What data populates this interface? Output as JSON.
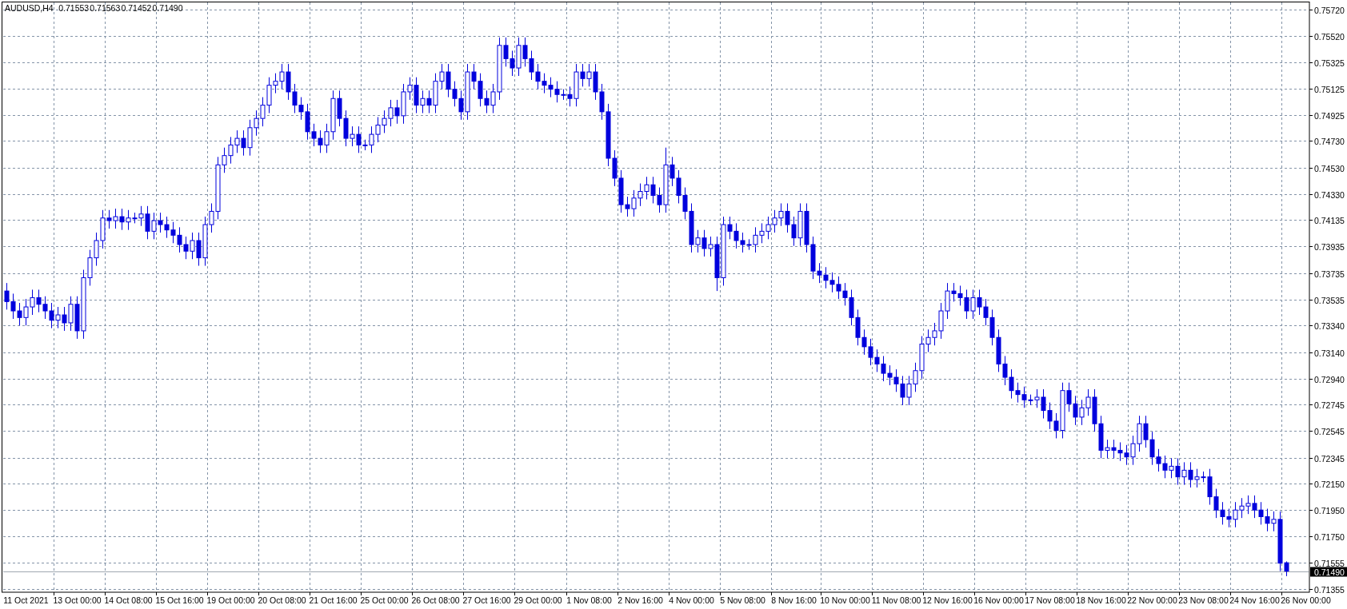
{
  "symbol": "AUDUSD,H4",
  "quote": [
    "0.71553",
    "0.71563",
    "0.71452",
    "0.71490"
  ],
  "chart_data": {
    "type": "candlestick",
    "grid": true,
    "ylim": [
      0.71331,
      0.75792
    ],
    "yticks": [
      {
        "value": 0.7572,
        "label": "0.75720"
      },
      {
        "value": 0.7552,
        "label": "0.75520"
      },
      {
        "value": 0.75325,
        "label": "0.75325"
      },
      {
        "value": 0.75125,
        "label": "0.75125"
      },
      {
        "value": 0.74925,
        "label": "0.74925"
      },
      {
        "value": 0.7473,
        "label": "0.74730"
      },
      {
        "value": 0.7453,
        "label": "0.74530"
      },
      {
        "value": 0.7433,
        "label": "0.74330"
      },
      {
        "value": 0.74135,
        "label": "0.74135"
      },
      {
        "value": 0.73935,
        "label": "0.73935"
      },
      {
        "value": 0.73735,
        "label": "0.73735"
      },
      {
        "value": 0.73535,
        "label": "0.73535"
      },
      {
        "value": 0.7334,
        "label": "0.73340"
      },
      {
        "value": 0.7314,
        "label": "0.73140"
      },
      {
        "value": 0.7294,
        "label": "0.72940"
      },
      {
        "value": 0.72745,
        "label": "0.72745"
      },
      {
        "value": 0.72545,
        "label": "0.72545"
      },
      {
        "value": 0.72345,
        "label": "0.72345"
      },
      {
        "value": 0.7215,
        "label": "0.72150"
      },
      {
        "value": 0.7195,
        "label": "0.71950"
      },
      {
        "value": 0.7175,
        "label": "0.71750"
      },
      {
        "value": 0.71555,
        "label": "0.71555"
      },
      {
        "value": 0.71355,
        "label": "0.71355"
      }
    ],
    "categories": [
      null,
      null,
      null,
      "11 Oct 2021",
      null,
      null,
      null,
      null,
      null,
      null,
      null,
      "13 Oct 00:00",
      null,
      null,
      null,
      null,
      null,
      null,
      null,
      "14 Oct 08:00",
      null,
      null,
      null,
      null,
      null,
      null,
      null,
      "15 Oct 16:00",
      null,
      null,
      null,
      null,
      null,
      null,
      null,
      "19 Oct 00:00",
      null,
      null,
      null,
      null,
      null,
      null,
      null,
      "20 Oct 08:00",
      null,
      null,
      null,
      null,
      null,
      null,
      null,
      "21 Oct 16:00",
      null,
      null,
      null,
      null,
      null,
      null,
      null,
      "25 Oct 00:00",
      null,
      null,
      null,
      null,
      null,
      null,
      null,
      "26 Oct 08:00",
      null,
      null,
      null,
      null,
      null,
      null,
      null,
      "27 Oct 16:00",
      null,
      null,
      null,
      null,
      null,
      null,
      null,
      "29 Oct 00:00",
      null,
      null,
      null,
      null,
      null,
      null,
      null,
      "1 Nov 08:00",
      null,
      null,
      null,
      null,
      null,
      null,
      null,
      "2 Nov 16:00",
      null,
      null,
      null,
      null,
      null,
      null,
      null,
      "4 Nov 00:00",
      null,
      null,
      null,
      null,
      null,
      null,
      null,
      "5 Nov 08:00",
      null,
      null,
      null,
      null,
      null,
      null,
      null,
      "8 Nov 16:00",
      null,
      null,
      null,
      null,
      null,
      null,
      null,
      "10 Nov 00:00",
      null,
      null,
      null,
      null,
      null,
      null,
      null,
      "11 Nov 08:00",
      null,
      null,
      null,
      null,
      null,
      null,
      null,
      "12 Nov 16:00",
      null,
      null,
      null,
      null,
      null,
      null,
      null,
      "16 Nov 00:00",
      null,
      null,
      null,
      null,
      null,
      null,
      null,
      "17 Nov 08:00",
      null,
      null,
      null,
      null,
      null,
      null,
      null,
      "18 Nov 16:00",
      null,
      null,
      null,
      null,
      null,
      null,
      null,
      "22 Nov 00:00",
      null,
      null,
      null,
      null,
      null,
      null,
      null,
      "23 Nov 08:00",
      null,
      null,
      null,
      null,
      null,
      null,
      null,
      "24 Nov 16:00",
      null,
      null,
      null,
      null,
      null,
      null,
      null,
      "26 Nov 00:00"
    ],
    "ref_lines": [
      {
        "axis": "y",
        "value": 0.7149,
        "label": "0.71490"
      }
    ],
    "ohlc": [
      [
        0.736,
        0.7366,
        0.7346,
        0.7352
      ],
      [
        0.7352,
        0.7358,
        0.7339,
        0.7345
      ],
      [
        0.7345,
        0.7351,
        0.7334,
        0.734
      ],
      [
        0.734,
        0.7354,
        0.7334,
        0.7348
      ],
      [
        0.7348,
        0.7361,
        0.7342,
        0.7355
      ],
      [
        0.7355,
        0.7361,
        0.7344,
        0.735
      ],
      [
        0.735,
        0.7356,
        0.7339,
        0.7345
      ],
      [
        0.7345,
        0.7351,
        0.7332,
        0.7338
      ],
      [
        0.7338,
        0.7348,
        0.7332,
        0.7342
      ],
      [
        0.7342,
        0.7348,
        0.733,
        0.7336
      ],
      [
        0.7336,
        0.7356,
        0.733,
        0.735
      ],
      [
        0.735,
        0.7356,
        0.7324,
        0.733
      ],
      [
        0.733,
        0.7376,
        0.7324,
        0.737
      ],
      [
        0.737,
        0.7391,
        0.7364,
        0.7385
      ],
      [
        0.7385,
        0.7404,
        0.7379,
        0.7398
      ],
      [
        0.7398,
        0.7421,
        0.7392,
        0.7415
      ],
      [
        0.7415,
        0.7421,
        0.7407,
        0.7413
      ],
      [
        0.7413,
        0.7422,
        0.7407,
        0.7416
      ],
      [
        0.7416,
        0.7422,
        0.7406,
        0.7412
      ],
      [
        0.7412,
        0.7421,
        0.7406,
        0.7415
      ],
      [
        0.7415,
        0.7419,
        0.7411,
        0.7415
      ],
      [
        0.7415,
        0.7424,
        0.7409,
        0.7418
      ],
      [
        0.7418,
        0.7424,
        0.7399,
        0.7405
      ],
      [
        0.7405,
        0.7419,
        0.7399,
        0.7413
      ],
      [
        0.7413,
        0.7419,
        0.7404,
        0.741
      ],
      [
        0.741,
        0.7416,
        0.74,
        0.7406
      ],
      [
        0.7406,
        0.7412,
        0.7396,
        0.7402
      ],
      [
        0.7402,
        0.7408,
        0.7389,
        0.7395
      ],
      [
        0.7395,
        0.7401,
        0.7384,
        0.739
      ],
      [
        0.739,
        0.7404,
        0.7384,
        0.7398
      ],
      [
        0.7398,
        0.7404,
        0.7379,
        0.7385
      ],
      [
        0.7385,
        0.7416,
        0.7379,
        0.741
      ],
      [
        0.741,
        0.7426,
        0.7404,
        0.742
      ],
      [
        0.742,
        0.7461,
        0.7414,
        0.7455
      ],
      [
        0.7455,
        0.7468,
        0.7449,
        0.7462
      ],
      [
        0.7462,
        0.7476,
        0.7456,
        0.747
      ],
      [
        0.747,
        0.7481,
        0.7464,
        0.7475
      ],
      [
        0.7475,
        0.7481,
        0.7462,
        0.7468
      ],
      [
        0.7468,
        0.7489,
        0.7462,
        0.7483
      ],
      [
        0.7483,
        0.7496,
        0.7477,
        0.749
      ],
      [
        0.749,
        0.7506,
        0.7484,
        0.75
      ],
      [
        0.75,
        0.7521,
        0.7494,
        0.7515
      ],
      [
        0.7515,
        0.7524,
        0.7509,
        0.7518
      ],
      [
        0.7518,
        0.7531,
        0.7512,
        0.7525
      ],
      [
        0.7525,
        0.7531,
        0.7504,
        0.751
      ],
      [
        0.751,
        0.7516,
        0.7494,
        0.75
      ],
      [
        0.75,
        0.7506,
        0.7489,
        0.7495
      ],
      [
        0.7495,
        0.7501,
        0.7474,
        0.748
      ],
      [
        0.748,
        0.7486,
        0.7469,
        0.7475
      ],
      [
        0.7475,
        0.7481,
        0.7464,
        0.747
      ],
      [
        0.747,
        0.7486,
        0.7464,
        0.748
      ],
      [
        0.748,
        0.7511,
        0.7474,
        0.7505
      ],
      [
        0.7505,
        0.7511,
        0.7484,
        0.749
      ],
      [
        0.749,
        0.7496,
        0.7469,
        0.7475
      ],
      [
        0.7475,
        0.7484,
        0.7469,
        0.7478
      ],
      [
        0.7478,
        0.7484,
        0.7464,
        0.747
      ],
      [
        0.747,
        0.7474,
        0.7466,
        0.747
      ],
      [
        0.747,
        0.7484,
        0.7464,
        0.7478
      ],
      [
        0.7478,
        0.7491,
        0.7472,
        0.7485
      ],
      [
        0.7485,
        0.7496,
        0.7479,
        0.749
      ],
      [
        0.749,
        0.7504,
        0.7484,
        0.7498
      ],
      [
        0.7498,
        0.7504,
        0.7486,
        0.7492
      ],
      [
        0.7492,
        0.7516,
        0.7486,
        0.751
      ],
      [
        0.751,
        0.7521,
        0.7504,
        0.7515
      ],
      [
        0.7515,
        0.7521,
        0.7494,
        0.75
      ],
      [
        0.75,
        0.7511,
        0.7494,
        0.7505
      ],
      [
        0.7505,
        0.7511,
        0.7494,
        0.75
      ],
      [
        0.75,
        0.7524,
        0.7494,
        0.7518
      ],
      [
        0.7518,
        0.7531,
        0.7512,
        0.7525
      ],
      [
        0.7525,
        0.7531,
        0.7506,
        0.7512
      ],
      [
        0.7512,
        0.7518,
        0.7499,
        0.7505
      ],
      [
        0.7505,
        0.7511,
        0.7489,
        0.7495
      ],
      [
        0.7495,
        0.7531,
        0.7489,
        0.7525
      ],
      [
        0.7525,
        0.7531,
        0.7512,
        0.7518
      ],
      [
        0.7518,
        0.7524,
        0.7499,
        0.7505
      ],
      [
        0.7505,
        0.7511,
        0.7494,
        0.75
      ],
      [
        0.75,
        0.7516,
        0.7494,
        0.751
      ],
      [
        0.751,
        0.7551,
        0.7504,
        0.7545
      ],
      [
        0.7545,
        0.7551,
        0.7529,
        0.7535
      ],
      [
        0.7535,
        0.7541,
        0.7522,
        0.7528
      ],
      [
        0.7528,
        0.7551,
        0.7522,
        0.7545
      ],
      [
        0.7545,
        0.7551,
        0.7529,
        0.7535
      ],
      [
        0.7535,
        0.7541,
        0.7519,
        0.7525
      ],
      [
        0.7525,
        0.7531,
        0.7512,
        0.7518
      ],
      [
        0.7518,
        0.7524,
        0.7509,
        0.7515
      ],
      [
        0.7515,
        0.7521,
        0.7506,
        0.7512
      ],
      [
        0.7512,
        0.7518,
        0.7502,
        0.7508
      ],
      [
        0.7508,
        0.7512,
        0.7504,
        0.7508
      ],
      [
        0.7508,
        0.7514,
        0.7499,
        0.7505
      ],
      [
        0.7505,
        0.7531,
        0.7499,
        0.7525
      ],
      [
        0.7525,
        0.7531,
        0.7514,
        0.752
      ],
      [
        0.752,
        0.7531,
        0.7514,
        0.7525
      ],
      [
        0.7525,
        0.7531,
        0.7504,
        0.751
      ],
      [
        0.751,
        0.7516,
        0.7489,
        0.7495
      ],
      [
        0.7495,
        0.7501,
        0.7454,
        0.746
      ],
      [
        0.746,
        0.7466,
        0.7439,
        0.7445
      ],
      [
        0.7445,
        0.7451,
        0.7419,
        0.7425
      ],
      [
        0.7425,
        0.7431,
        0.7416,
        0.7422
      ],
      [
        0.7422,
        0.7436,
        0.7416,
        0.743
      ],
      [
        0.743,
        0.7441,
        0.7424,
        0.7435
      ],
      [
        0.7435,
        0.7446,
        0.7429,
        0.744
      ],
      [
        0.744,
        0.7446,
        0.7426,
        0.7432
      ],
      [
        0.7432,
        0.7438,
        0.7419,
        0.7425
      ],
      [
        0.7425,
        0.7468,
        0.7419,
        0.7455
      ],
      [
        0.7455,
        0.7461,
        0.7439,
        0.7445
      ],
      [
        0.7445,
        0.7451,
        0.7426,
        0.7432
      ],
      [
        0.7432,
        0.7438,
        0.7414,
        0.742
      ],
      [
        0.742,
        0.7426,
        0.7389,
        0.7395
      ],
      [
        0.7395,
        0.7406,
        0.7389,
        0.74
      ],
      [
        0.74,
        0.7406,
        0.7386,
        0.7392
      ],
      [
        0.7392,
        0.7401,
        0.7386,
        0.7395
      ],
      [
        0.7395,
        0.7401,
        0.736,
        0.737
      ],
      [
        0.737,
        0.7416,
        0.7364,
        0.741
      ],
      [
        0.741,
        0.7416,
        0.7399,
        0.7405
      ],
      [
        0.7405,
        0.7411,
        0.7392,
        0.7398
      ],
      [
        0.7398,
        0.7404,
        0.7389,
        0.7395
      ],
      [
        0.7395,
        0.7399,
        0.7391,
        0.7395
      ],
      [
        0.7395,
        0.7408,
        0.7389,
        0.7402
      ],
      [
        0.7402,
        0.7411,
        0.7396,
        0.7405
      ],
      [
        0.7405,
        0.7416,
        0.7399,
        0.741
      ],
      [
        0.741,
        0.7421,
        0.7404,
        0.7415
      ],
      [
        0.7415,
        0.7426,
        0.7409,
        0.742
      ],
      [
        0.742,
        0.7426,
        0.7404,
        0.741
      ],
      [
        0.741,
        0.7416,
        0.7394,
        0.74
      ],
      [
        0.74,
        0.7426,
        0.7394,
        0.742
      ],
      [
        0.742,
        0.7426,
        0.7389,
        0.7395
      ],
      [
        0.7395,
        0.7401,
        0.7369,
        0.7375
      ],
      [
        0.7375,
        0.7381,
        0.7366,
        0.7372
      ],
      [
        0.7372,
        0.7378,
        0.7362,
        0.7368
      ],
      [
        0.7368,
        0.7374,
        0.7359,
        0.7365
      ],
      [
        0.7365,
        0.7371,
        0.7354,
        0.736
      ],
      [
        0.736,
        0.7366,
        0.7349,
        0.7355
      ],
      [
        0.7355,
        0.7361,
        0.7334,
        0.734
      ],
      [
        0.734,
        0.7346,
        0.7319,
        0.7325
      ],
      [
        0.7325,
        0.7331,
        0.7312,
        0.7318
      ],
      [
        0.7318,
        0.7324,
        0.7304,
        0.731
      ],
      [
        0.731,
        0.7316,
        0.7299,
        0.7305
      ],
      [
        0.7305,
        0.7311,
        0.7292,
        0.7298
      ],
      [
        0.7298,
        0.7304,
        0.7289,
        0.7295
      ],
      [
        0.7295,
        0.7301,
        0.7284,
        0.729
      ],
      [
        0.729,
        0.7296,
        0.7274,
        0.728
      ],
      [
        0.728,
        0.7296,
        0.7274,
        0.729
      ],
      [
        0.729,
        0.7306,
        0.7284,
        0.73
      ],
      [
        0.73,
        0.7326,
        0.7294,
        0.732
      ],
      [
        0.732,
        0.7331,
        0.7314,
        0.7325
      ],
      [
        0.7325,
        0.7336,
        0.7319,
        0.733
      ],
      [
        0.733,
        0.7351,
        0.7324,
        0.7345
      ],
      [
        0.7345,
        0.7366,
        0.7339,
        0.736
      ],
      [
        0.736,
        0.7366,
        0.7352,
        0.7358
      ],
      [
        0.7358,
        0.7364,
        0.7349,
        0.7355
      ],
      [
        0.7355,
        0.7361,
        0.7339,
        0.7345
      ],
      [
        0.7345,
        0.7361,
        0.7339,
        0.7355
      ],
      [
        0.7355,
        0.7361,
        0.7342,
        0.7348
      ],
      [
        0.7348,
        0.7354,
        0.7334,
        0.734
      ],
      [
        0.734,
        0.7346,
        0.7319,
        0.7325
      ],
      [
        0.7325,
        0.7331,
        0.7299,
        0.7305
      ],
      [
        0.7305,
        0.7311,
        0.7289,
        0.7295
      ],
      [
        0.7295,
        0.7301,
        0.7279,
        0.7285
      ],
      [
        0.7285,
        0.7291,
        0.7276,
        0.7282
      ],
      [
        0.7282,
        0.7288,
        0.7272,
        0.7278
      ],
      [
        0.7278,
        0.7282,
        0.7274,
        0.7278
      ],
      [
        0.7278,
        0.7286,
        0.7272,
        0.728
      ],
      [
        0.728,
        0.7286,
        0.7264,
        0.727
      ],
      [
        0.727,
        0.7276,
        0.7256,
        0.7262
      ],
      [
        0.7262,
        0.7268,
        0.7249,
        0.7255
      ],
      [
        0.7255,
        0.7291,
        0.7249,
        0.7285
      ],
      [
        0.7285,
        0.7291,
        0.7269,
        0.7275
      ],
      [
        0.7275,
        0.7281,
        0.7259,
        0.7265
      ],
      [
        0.7265,
        0.7278,
        0.7259,
        0.7272
      ],
      [
        0.7272,
        0.7286,
        0.7266,
        0.728
      ],
      [
        0.728,
        0.7286,
        0.7254,
        0.726
      ],
      [
        0.726,
        0.7266,
        0.7234,
        0.724
      ],
      [
        0.724,
        0.7248,
        0.7234,
        0.7242
      ],
      [
        0.7242,
        0.7248,
        0.7234,
        0.724
      ],
      [
        0.724,
        0.7246,
        0.7232,
        0.7238
      ],
      [
        0.7238,
        0.7244,
        0.7229,
        0.7235
      ],
      [
        0.7235,
        0.7251,
        0.7229,
        0.7245
      ],
      [
        0.7245,
        0.7266,
        0.7239,
        0.726
      ],
      [
        0.726,
        0.7266,
        0.7242,
        0.7248
      ],
      [
        0.7248,
        0.7254,
        0.7229,
        0.7235
      ],
      [
        0.7235,
        0.7241,
        0.7224,
        0.723
      ],
      [
        0.723,
        0.7236,
        0.7219,
        0.7225
      ],
      [
        0.7225,
        0.7234,
        0.7219,
        0.7228
      ],
      [
        0.7228,
        0.7234,
        0.7214,
        0.722
      ],
      [
        0.722,
        0.7231,
        0.7214,
        0.7225
      ],
      [
        0.7225,
        0.7231,
        0.7212,
        0.7218
      ],
      [
        0.7218,
        0.7226,
        0.7212,
        0.722
      ],
      [
        0.722,
        0.7224,
        0.7216,
        0.722
      ],
      [
        0.722,
        0.7226,
        0.7199,
        0.7205
      ],
      [
        0.7205,
        0.7211,
        0.7189,
        0.7195
      ],
      [
        0.7195,
        0.7201,
        0.7184,
        0.719
      ],
      [
        0.719,
        0.7196,
        0.7182,
        0.7188
      ],
      [
        0.7188,
        0.7201,
        0.7182,
        0.7195
      ],
      [
        0.7195,
        0.7204,
        0.7189,
        0.7198
      ],
      [
        0.7198,
        0.7206,
        0.7192,
        0.72
      ],
      [
        0.72,
        0.7206,
        0.7189,
        0.7195
      ],
      [
        0.7195,
        0.7201,
        0.7184,
        0.719
      ],
      [
        0.719,
        0.7196,
        0.7179,
        0.7185
      ],
      [
        0.7185,
        0.7194,
        0.7179,
        0.7188
      ],
      [
        0.7188,
        0.7194,
        0.7149,
        0.7155
      ],
      [
        0.71553,
        0.71563,
        0.71452,
        0.7149
      ],
      null,
      null,
      null
    ]
  }
}
